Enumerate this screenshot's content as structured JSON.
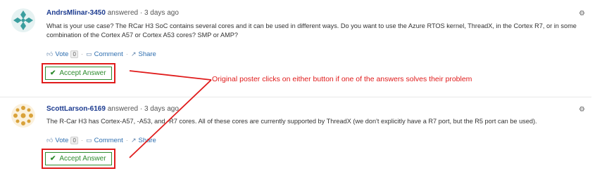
{
  "answers": [
    {
      "author": "AndrsMlinar-3450",
      "action": "answered",
      "time": "3 days ago",
      "body": "What is your use case? The RCar H3 SoC contains several cores and it can be used in different ways. Do you want to use the Azure RTOS kernel, ThreadX, in the Cortex R7, or in some combination of the Cortex A57 or Cortex A53 cores? SMP or AMP?",
      "vote_label": "Vote",
      "vote_count": "0",
      "comment_label": "Comment",
      "share_label": "Share",
      "accept_label": "Accept Answer",
      "avatar_color": "#3a9e9e"
    },
    {
      "author": "ScottLarson-6169",
      "action": "answered",
      "time": "3 days ago",
      "body": "The R-Car H3 has Cortex-A57, -A53, and -R7 cores. All of these cores are currently supported by ThreadX (we don't explicitly have a R7 port, but the R5 port can be used).",
      "vote_label": "Vote",
      "vote_count": "0",
      "comment_label": "Comment",
      "share_label": "Share",
      "accept_label": "Accept Answer",
      "avatar_color": "#d9a23a"
    }
  ],
  "annotation": {
    "text": "Original poster clicks on either button if one of the answers solves their problem",
    "color": "#e01b1b"
  },
  "icons": {
    "gear": "gear-icon",
    "vote": "thumbs-up-icon",
    "comment": "comment-icon",
    "share": "share-icon",
    "check": "checkmark-icon"
  }
}
